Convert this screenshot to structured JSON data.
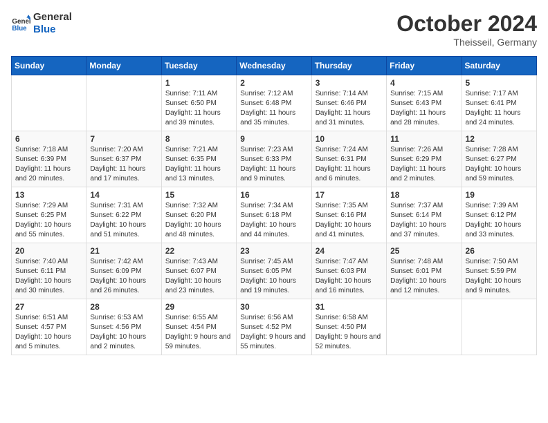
{
  "header": {
    "logo_line1": "General",
    "logo_line2": "Blue",
    "month_title": "October 2024",
    "location": "Theisseil, Germany"
  },
  "weekdays": [
    "Sunday",
    "Monday",
    "Tuesday",
    "Wednesday",
    "Thursday",
    "Friday",
    "Saturday"
  ],
  "weeks": [
    [
      {
        "day": "",
        "sunrise": "",
        "sunset": "",
        "daylight": ""
      },
      {
        "day": "",
        "sunrise": "",
        "sunset": "",
        "daylight": ""
      },
      {
        "day": "1",
        "sunrise": "Sunrise: 7:11 AM",
        "sunset": "Sunset: 6:50 PM",
        "daylight": "Daylight: 11 hours and 39 minutes."
      },
      {
        "day": "2",
        "sunrise": "Sunrise: 7:12 AM",
        "sunset": "Sunset: 6:48 PM",
        "daylight": "Daylight: 11 hours and 35 minutes."
      },
      {
        "day": "3",
        "sunrise": "Sunrise: 7:14 AM",
        "sunset": "Sunset: 6:46 PM",
        "daylight": "Daylight: 11 hours and 31 minutes."
      },
      {
        "day": "4",
        "sunrise": "Sunrise: 7:15 AM",
        "sunset": "Sunset: 6:43 PM",
        "daylight": "Daylight: 11 hours and 28 minutes."
      },
      {
        "day": "5",
        "sunrise": "Sunrise: 7:17 AM",
        "sunset": "Sunset: 6:41 PM",
        "daylight": "Daylight: 11 hours and 24 minutes."
      }
    ],
    [
      {
        "day": "6",
        "sunrise": "Sunrise: 7:18 AM",
        "sunset": "Sunset: 6:39 PM",
        "daylight": "Daylight: 11 hours and 20 minutes."
      },
      {
        "day": "7",
        "sunrise": "Sunrise: 7:20 AM",
        "sunset": "Sunset: 6:37 PM",
        "daylight": "Daylight: 11 hours and 17 minutes."
      },
      {
        "day": "8",
        "sunrise": "Sunrise: 7:21 AM",
        "sunset": "Sunset: 6:35 PM",
        "daylight": "Daylight: 11 hours and 13 minutes."
      },
      {
        "day": "9",
        "sunrise": "Sunrise: 7:23 AM",
        "sunset": "Sunset: 6:33 PM",
        "daylight": "Daylight: 11 hours and 9 minutes."
      },
      {
        "day": "10",
        "sunrise": "Sunrise: 7:24 AM",
        "sunset": "Sunset: 6:31 PM",
        "daylight": "Daylight: 11 hours and 6 minutes."
      },
      {
        "day": "11",
        "sunrise": "Sunrise: 7:26 AM",
        "sunset": "Sunset: 6:29 PM",
        "daylight": "Daylight: 11 hours and 2 minutes."
      },
      {
        "day": "12",
        "sunrise": "Sunrise: 7:28 AM",
        "sunset": "Sunset: 6:27 PM",
        "daylight": "Daylight: 10 hours and 59 minutes."
      }
    ],
    [
      {
        "day": "13",
        "sunrise": "Sunrise: 7:29 AM",
        "sunset": "Sunset: 6:25 PM",
        "daylight": "Daylight: 10 hours and 55 minutes."
      },
      {
        "day": "14",
        "sunrise": "Sunrise: 7:31 AM",
        "sunset": "Sunset: 6:22 PM",
        "daylight": "Daylight: 10 hours and 51 minutes."
      },
      {
        "day": "15",
        "sunrise": "Sunrise: 7:32 AM",
        "sunset": "Sunset: 6:20 PM",
        "daylight": "Daylight: 10 hours and 48 minutes."
      },
      {
        "day": "16",
        "sunrise": "Sunrise: 7:34 AM",
        "sunset": "Sunset: 6:18 PM",
        "daylight": "Daylight: 10 hours and 44 minutes."
      },
      {
        "day": "17",
        "sunrise": "Sunrise: 7:35 AM",
        "sunset": "Sunset: 6:16 PM",
        "daylight": "Daylight: 10 hours and 41 minutes."
      },
      {
        "day": "18",
        "sunrise": "Sunrise: 7:37 AM",
        "sunset": "Sunset: 6:14 PM",
        "daylight": "Daylight: 10 hours and 37 minutes."
      },
      {
        "day": "19",
        "sunrise": "Sunrise: 7:39 AM",
        "sunset": "Sunset: 6:12 PM",
        "daylight": "Daylight: 10 hours and 33 minutes."
      }
    ],
    [
      {
        "day": "20",
        "sunrise": "Sunrise: 7:40 AM",
        "sunset": "Sunset: 6:11 PM",
        "daylight": "Daylight: 10 hours and 30 minutes."
      },
      {
        "day": "21",
        "sunrise": "Sunrise: 7:42 AM",
        "sunset": "Sunset: 6:09 PM",
        "daylight": "Daylight: 10 hours and 26 minutes."
      },
      {
        "day": "22",
        "sunrise": "Sunrise: 7:43 AM",
        "sunset": "Sunset: 6:07 PM",
        "daylight": "Daylight: 10 hours and 23 minutes."
      },
      {
        "day": "23",
        "sunrise": "Sunrise: 7:45 AM",
        "sunset": "Sunset: 6:05 PM",
        "daylight": "Daylight: 10 hours and 19 minutes."
      },
      {
        "day": "24",
        "sunrise": "Sunrise: 7:47 AM",
        "sunset": "Sunset: 6:03 PM",
        "daylight": "Daylight: 10 hours and 16 minutes."
      },
      {
        "day": "25",
        "sunrise": "Sunrise: 7:48 AM",
        "sunset": "Sunset: 6:01 PM",
        "daylight": "Daylight: 10 hours and 12 minutes."
      },
      {
        "day": "26",
        "sunrise": "Sunrise: 7:50 AM",
        "sunset": "Sunset: 5:59 PM",
        "daylight": "Daylight: 10 hours and 9 minutes."
      }
    ],
    [
      {
        "day": "27",
        "sunrise": "Sunrise: 6:51 AM",
        "sunset": "Sunset: 4:57 PM",
        "daylight": "Daylight: 10 hours and 5 minutes."
      },
      {
        "day": "28",
        "sunrise": "Sunrise: 6:53 AM",
        "sunset": "Sunset: 4:56 PM",
        "daylight": "Daylight: 10 hours and 2 minutes."
      },
      {
        "day": "29",
        "sunrise": "Sunrise: 6:55 AM",
        "sunset": "Sunset: 4:54 PM",
        "daylight": "Daylight: 9 hours and 59 minutes."
      },
      {
        "day": "30",
        "sunrise": "Sunrise: 6:56 AM",
        "sunset": "Sunset: 4:52 PM",
        "daylight": "Daylight: 9 hours and 55 minutes."
      },
      {
        "day": "31",
        "sunrise": "Sunrise: 6:58 AM",
        "sunset": "Sunset: 4:50 PM",
        "daylight": "Daylight: 9 hours and 52 minutes."
      },
      {
        "day": "",
        "sunrise": "",
        "sunset": "",
        "daylight": ""
      },
      {
        "day": "",
        "sunrise": "",
        "sunset": "",
        "daylight": ""
      }
    ]
  ]
}
